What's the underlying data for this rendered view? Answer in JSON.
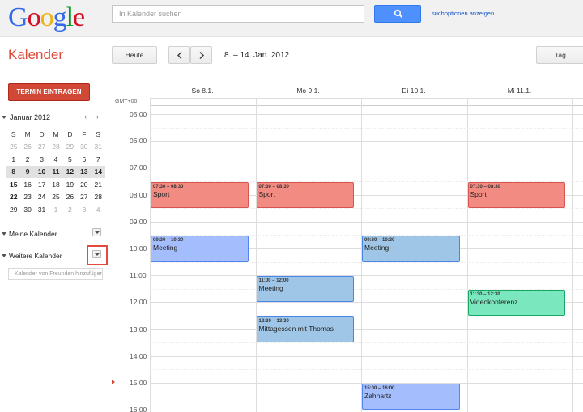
{
  "header": {
    "logo_letters": [
      {
        "ch": "G",
        "color": "#3369e8"
      },
      {
        "ch": "o",
        "color": "#d50f25"
      },
      {
        "ch": "o",
        "color": "#eeb211"
      },
      {
        "ch": "g",
        "color": "#3369e8"
      },
      {
        "ch": "l",
        "color": "#009925"
      },
      {
        "ch": "e",
        "color": "#d50f25"
      }
    ],
    "search_placeholder": "In Kalender suchen",
    "search_options_label": "suchoptionen anzeigen"
  },
  "toolbar": {
    "app_name": "Kalender",
    "today_label": "Heute",
    "date_range": "8. – 14. Jan. 2012",
    "view_label": "Tag"
  },
  "sidebar": {
    "create_label": "TERMIN EINTRAGEN",
    "mini_calendar": {
      "title": "Januar 2012",
      "prev": "‹",
      "next": "›",
      "weekdays": [
        "S",
        "M",
        "D",
        "M",
        "D",
        "F",
        "S"
      ],
      "weeks": [
        [
          "25",
          "26",
          "27",
          "28",
          "29",
          "30",
          "31"
        ],
        [
          "1",
          "2",
          "3",
          "4",
          "5",
          "6",
          "7"
        ],
        [
          "8",
          "9",
          "10",
          "11",
          "12",
          "13",
          "14"
        ],
        [
          "15",
          "16",
          "17",
          "18",
          "19",
          "20",
          "21"
        ],
        [
          "22",
          "23",
          "24",
          "25",
          "26",
          "27",
          "28"
        ],
        [
          "29",
          "30",
          "31",
          "1",
          "2",
          "3",
          "4"
        ]
      ]
    },
    "my_calendars_label": "Meine Kalender",
    "other_calendars_label": "Weitere Kalender",
    "friend_placeholder": "Kalender von Freunden hinzufügen"
  },
  "grid": {
    "gmt_label": "GMT+00",
    "days": [
      "So 8.1.",
      "Mo 9.1.",
      "Di 10.1.",
      "Mi 11.1."
    ],
    "hours": [
      "05:00",
      "06:00",
      "07:00",
      "08:00",
      "09:00",
      "10:00",
      "11:00",
      "12:00",
      "13:00",
      "14:00",
      "15:00",
      "16:00"
    ],
    "events": [
      {
        "day": 0,
        "time": "07:30 – 08:30",
        "title": "Sport",
        "start": 7.5,
        "end": 8.5,
        "bg": "#f28b82",
        "border": "#d9534f"
      },
      {
        "day": 1,
        "time": "07:30 – 08:30",
        "title": "Sport",
        "start": 7.5,
        "end": 8.5,
        "bg": "#f28b82",
        "border": "#d9534f"
      },
      {
        "day": 3,
        "time": "07:30 – 08:30",
        "title": "Sport",
        "start": 7.5,
        "end": 8.5,
        "bg": "#f28b82",
        "border": "#d9534f"
      },
      {
        "day": 0,
        "time": "09:30 – 10:30",
        "title": "Meeting",
        "start": 9.5,
        "end": 10.5,
        "bg": "#a4bdfc",
        "border": "#5484ed"
      },
      {
        "day": 2,
        "time": "09:30 – 10:30",
        "title": "Meeting",
        "start": 9.5,
        "end": 10.5,
        "bg": "#9fc6e7",
        "border": "#4a86e8"
      },
      {
        "day": 1,
        "time": "11:00 – 12:00",
        "title": "Meeting",
        "start": 11,
        "end": 12,
        "bg": "#9fc6e7",
        "border": "#4a86e8"
      },
      {
        "day": 3,
        "time": "11:30 – 12:30",
        "title": "Videokonferenz",
        "start": 11.5,
        "end": 12.5,
        "bg": "#7ae7bf",
        "border": "#16a765"
      },
      {
        "day": 1,
        "time": "12:30 – 13:30",
        "title": "Mittagessen mit Thomas",
        "start": 12.5,
        "end": 13.5,
        "bg": "#9fc6e7",
        "border": "#4a86e8"
      },
      {
        "day": 2,
        "time": "15:00 – 16:00",
        "title": "Zahnartz",
        "start": 15,
        "end": 16,
        "bg": "#a4bdfc",
        "border": "#5484ed"
      }
    ]
  }
}
